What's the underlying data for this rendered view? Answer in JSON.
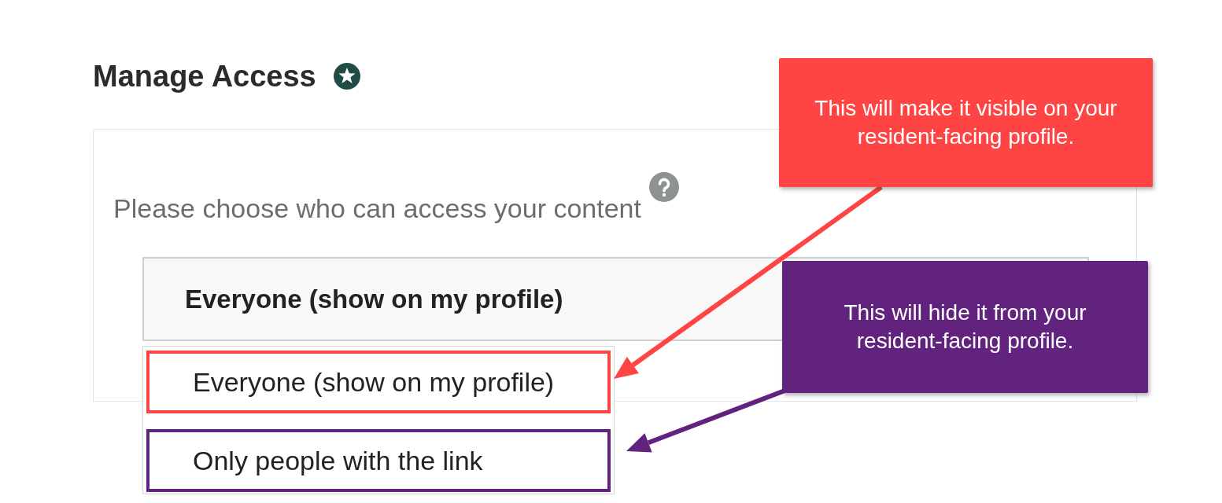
{
  "heading": {
    "title": "Manage Access"
  },
  "prompt": "Please choose who can access your content",
  "select": {
    "value": "Everyone (show on my profile)",
    "expanded": true,
    "options": [
      {
        "label": "Everyone (show on my profile)",
        "color": "#ff4444"
      },
      {
        "label": "Only people with the link",
        "color": "#62237f"
      }
    ]
  },
  "callouts": [
    {
      "text": "This will make it visible on your resident-facing profile.",
      "color": "#ff4444"
    },
    {
      "text": "This will hide it from your resident-facing profile.",
      "color": "#62237f"
    }
  ]
}
